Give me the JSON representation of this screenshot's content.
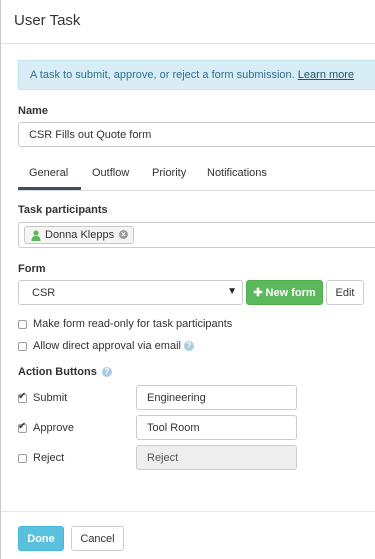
{
  "dialog": {
    "title": "User Task"
  },
  "info": {
    "text": "A task to submit, approve, or reject a form submission.",
    "link": "Learn more"
  },
  "name": {
    "label": "Name",
    "value": "CSR Fills out Quote form"
  },
  "tabs": [
    {
      "label": "General",
      "active": true
    },
    {
      "label": "Outflow",
      "active": false
    },
    {
      "label": "Priority",
      "active": false
    },
    {
      "label": "Notifications",
      "active": false
    }
  ],
  "participants": {
    "label": "Task participants",
    "items": [
      {
        "name": "Donna Klepps"
      }
    ]
  },
  "form": {
    "label": "Form",
    "selected": "CSR",
    "new_form_label": "New form",
    "edit_label": "Edit",
    "options": [
      {
        "label": "Make form read-only for task participants",
        "checked": false
      },
      {
        "label": "Allow direct approval via email",
        "checked": false,
        "help": true
      }
    ]
  },
  "action_buttons": {
    "label": "Action Buttons",
    "items": [
      {
        "label": "Submit",
        "checked": true,
        "value": "Engineering",
        "disabled": false
      },
      {
        "label": "Approve",
        "checked": true,
        "value": "Tool Room",
        "disabled": false
      },
      {
        "label": "Reject",
        "checked": false,
        "value": "Reject",
        "disabled": true
      }
    ]
  },
  "footer": {
    "done_label": "Done",
    "cancel_label": "Cancel"
  },
  "colors": {
    "accent_blue": "#5bc0de",
    "success_green": "#5cb85c",
    "info_bg": "#d9edf7",
    "tab_active": "#3b5168"
  }
}
